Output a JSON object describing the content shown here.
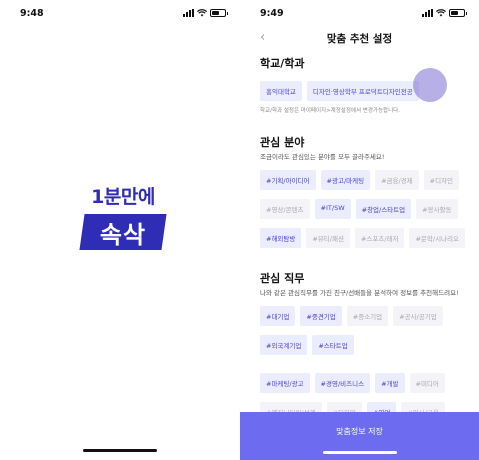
{
  "left_screen": {
    "status_time": "9:48",
    "logo_line1": "1분만에",
    "logo_line2": "속삭"
  },
  "right_screen": {
    "status_time": "9:49",
    "nav": {
      "back_glyph": "‹",
      "title": "맞춤 추천 설정"
    },
    "school": {
      "title": "학교/학과",
      "chips": [
        "홍익대학교",
        "디자인·영상학부 프로덕트디자인전공"
      ],
      "note": "학교/학과 설정은 마이페이지>계정설정에서 변경가능합니다."
    },
    "interest": {
      "title": "관심 분야",
      "subtitle": "조금이라도 관심있는 분야를 모두 골라주세요!",
      "chips": [
        {
          "label": "#기획/아이디어",
          "selected": true
        },
        {
          "label": "#광고/마케팅",
          "selected": true
        },
        {
          "label": "#금융/경제",
          "selected": false
        },
        {
          "label": "#디자인",
          "selected": false
        },
        {
          "label": "#영상/콘텐츠",
          "selected": false
        },
        {
          "label": "#IT/SW",
          "selected": true
        },
        {
          "label": "#창업/스타트업",
          "selected": true
        },
        {
          "label": "#봉사활동",
          "selected": false
        },
        {
          "label": "#해외탐방",
          "selected": true
        },
        {
          "label": "#뷰티/패션",
          "selected": false
        },
        {
          "label": "#스포츠/레저",
          "selected": false
        },
        {
          "label": "#문학/시나리오",
          "selected": false
        }
      ]
    },
    "job": {
      "title": "관심 직무",
      "subtitle": "나와 같은 관심직무를 가진 친구/선배들을 분석하여 정보를 추천해드려요!",
      "company_chips": [
        {
          "label": "#대기업",
          "selected": true
        },
        {
          "label": "#중견기업",
          "selected": true
        },
        {
          "label": "#중소기업",
          "selected": false
        },
        {
          "label": "#공사/공기업",
          "selected": false
        },
        {
          "label": "#외국계기업",
          "selected": true
        },
        {
          "label": "#스타트업",
          "selected": true
        }
      ],
      "role_chips": [
        {
          "label": "#마케팅/광고",
          "selected": true
        },
        {
          "label": "#경영/비즈니스",
          "selected": true
        },
        {
          "label": "#개발",
          "selected": true
        },
        {
          "label": "#미디어",
          "selected": false
        },
        {
          "label": "#엔지니어링/설계",
          "selected": false
        },
        {
          "label": "#디자인",
          "selected": false
        },
        {
          "label": "#영업",
          "selected": true
        },
        {
          "label": "#인사/교육",
          "selected": false
        }
      ]
    },
    "save_label": "맞춤정보 저장"
  },
  "colors": {
    "brand": "#2f2db5",
    "accent": "#6d6cf0",
    "chip_selected_bg": "#ececff",
    "chip_selected_text": "#4b47c8"
  }
}
